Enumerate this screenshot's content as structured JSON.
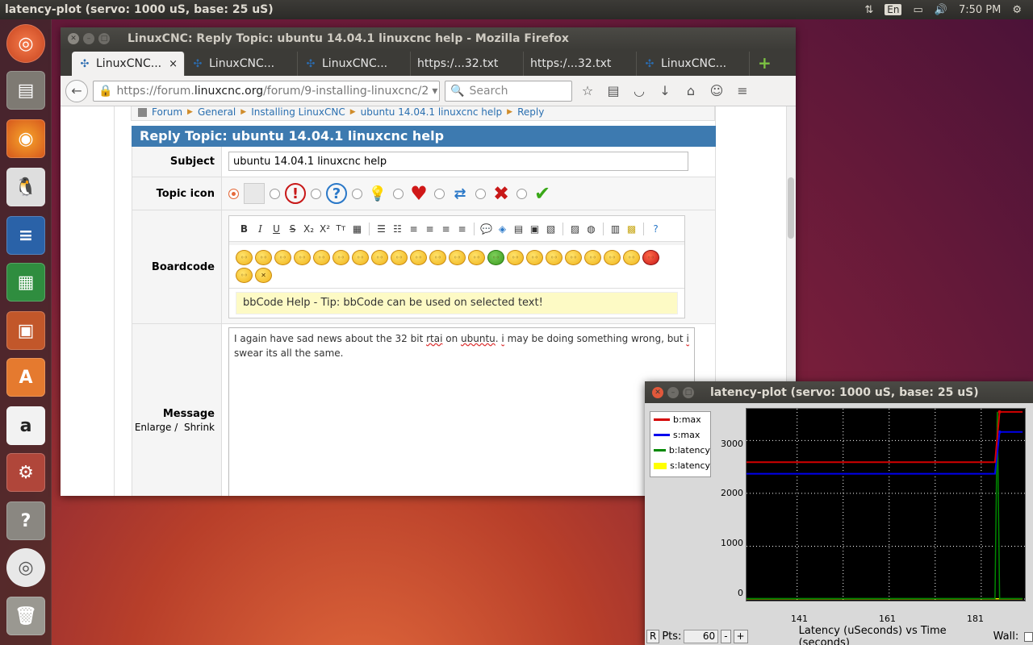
{
  "top_panel": {
    "title": "latency-plot (servo: 1000 uS, base: 25 uS)",
    "keyboard": "En",
    "clock": "7:50 PM"
  },
  "launcher": {
    "items": [
      "ubuntu-dash",
      "files",
      "firefox",
      "penguin-app",
      "libreoffice-writer",
      "libreoffice-calc",
      "libreoffice-impress",
      "software-center",
      "amazon",
      "system-settings",
      "help",
      "dvd",
      "trash"
    ]
  },
  "firefox": {
    "window_title": "LinuxCNC: Reply Topic: ubuntu 14.04.1 linuxcnc help - Mozilla Firefox",
    "tabs": [
      {
        "label": "LinuxCNC...",
        "icon": "joomla-icon",
        "active": true
      },
      {
        "label": "LinuxCNC...",
        "icon": "joomla-icon"
      },
      {
        "label": "LinuxCNC...",
        "icon": "joomla-icon"
      },
      {
        "label": "https:/...32.txt"
      },
      {
        "label": "https:/...32.txt"
      },
      {
        "label": "LinuxCNC...",
        "icon": "joomla-icon"
      }
    ],
    "tab_close": "×",
    "new_tab": "+",
    "url_prefix": "https://forum.",
    "url_host": "linuxcnc.org",
    "url_path": "/forum/9-installing-linuxcnc/2",
    "search_placeholder": "Search"
  },
  "page": {
    "breadcrumb": [
      "Forum",
      "General",
      "Installing LinuxCNC",
      "ubuntu 14.04.1 linuxcnc help",
      "Reply"
    ],
    "form_title": "Reply Topic: ubuntu 14.04.1 linuxcnc help",
    "subject_label": "Subject",
    "subject_value": "ubuntu 14.04.1 linuxcnc help",
    "topic_icon_label": "Topic icon",
    "boardcode_label": "Boardcode",
    "toolbar_bold": "B",
    "toolbar_italic": "I",
    "toolbar_underline": "U",
    "toolbar_strike": "S",
    "toolbar_sub": "X₂",
    "toolbar_sup": "X²",
    "toolbar_size": "Tт",
    "bbcode_help": "bbCode Help - Tip: bbCode can be used on selected text!",
    "message_label": "Message",
    "enlarge": "Enlarge",
    "slash": "/",
    "shrink": "Shrink",
    "message_part1": "I again have sad news about the 32 bit ",
    "message_rtai": "rtai",
    "message_part2": " on ",
    "message_ubuntu": "ubuntu",
    "message_part3": ". ",
    "message_i": "i",
    "message_part4": " may be doing something wrong, but ",
    "message_i2": "i",
    "message_part5": " swear its all the same."
  },
  "plot": {
    "window_title": "latency-plot (servo: 1000 uS, base: 25 uS)",
    "legend": [
      {
        "name": "b:max",
        "color": "#d40000"
      },
      {
        "name": "s:max",
        "color": "#0000ee"
      },
      {
        "name": "b:latency",
        "color": "#008800"
      },
      {
        "name": "s:latency",
        "color": "#ffff00"
      }
    ],
    "y_ticks": [
      "3000",
      "2000",
      "1000",
      "0"
    ],
    "x_ticks": [
      "141",
      "161",
      "181"
    ],
    "reset_btn": "R",
    "pts_label": "Pts:",
    "pts_value": "60",
    "minus": "-",
    "plus": "+",
    "caption": "Latency (uSeconds) vs Time (seconds)",
    "wall_label": "Wall:"
  },
  "chart_data": {
    "type": "line",
    "xlabel": "Latency (uSeconds) vs Time (seconds)",
    "ylim": [
      -30,
      3600
    ],
    "xlim": [
      141,
      200
    ],
    "grid": true,
    "legend": "top-left",
    "series": [
      {
        "name": "b:max",
        "x": [
          130,
          184,
          185,
          190
        ],
        "values": [
          2590,
          2590,
          3540,
          3540
        ]
      },
      {
        "name": "s:max",
        "x": [
          130,
          184,
          185,
          190
        ],
        "values": [
          2370,
          2370,
          3160,
          3160
        ]
      },
      {
        "name": "b:latency",
        "x": [
          130,
          184,
          184.5,
          185,
          185.5,
          190
        ],
        "values": [
          10,
          10,
          3540,
          10,
          10,
          10
        ]
      },
      {
        "name": "s:latency",
        "x": [
          130,
          190
        ],
        "values": [
          5,
          5
        ]
      }
    ]
  }
}
